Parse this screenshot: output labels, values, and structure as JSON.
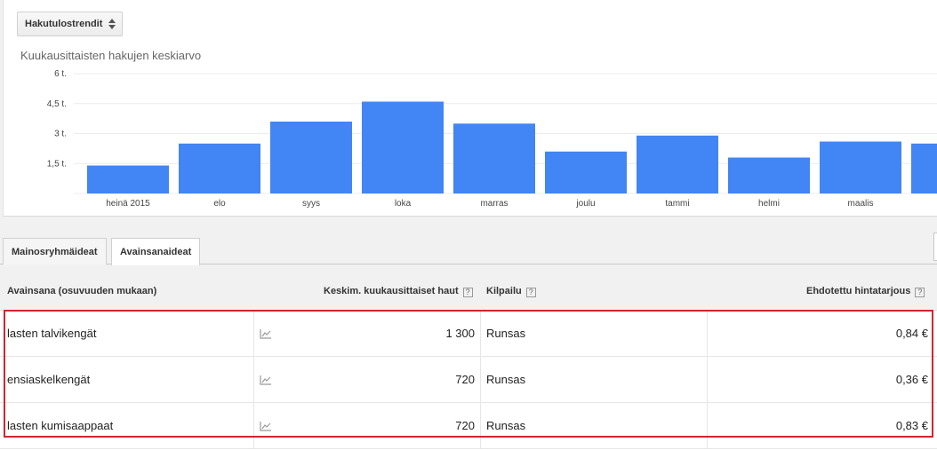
{
  "toolbar": {
    "select_label": "Hakutulostrendit",
    "select_icon": "sort-arrows-icon"
  },
  "chart_title": "Kuukausittaisten hakujen keskiarvo",
  "chart_data": {
    "type": "bar",
    "title": "Kuukausittaisten hakujen keskiarvo",
    "categories": [
      "heinä 2015",
      "elo",
      "syys",
      "loka",
      "marras",
      "joulu",
      "tammi",
      "helmi",
      "maalis",
      ""
    ],
    "values": [
      1.4,
      2.5,
      3.6,
      4.6,
      3.5,
      2.1,
      2.9,
      1.8,
      2.6,
      2.5
    ],
    "y_ticks": [
      1.5,
      3,
      4.5,
      6
    ],
    "y_tick_labels": [
      "1,5 t.",
      "3 t.",
      "4,5 t.",
      "6 t."
    ],
    "ylim": [
      0,
      6
    ],
    "bar_color": "#4285f4",
    "grid": true
  },
  "tabs": [
    {
      "label": "Mainosryhmäideat",
      "active": false
    },
    {
      "label": "Avainsanaideat",
      "active": true
    }
  ],
  "table": {
    "headers": {
      "keyword": "Avainsana (osuvuuden mukaan)",
      "avg": "Keskim. kuukausittaiset haut",
      "competition": "Kilpailu",
      "bid": "Ehdotettu hintatarjous"
    },
    "help_glyph": "?",
    "rows": [
      {
        "keyword": "lasten talvikengät",
        "avg": "1 300",
        "competition": "Runsas",
        "bid": "0,84 €"
      },
      {
        "keyword": "ensiaskelkengät",
        "avg": "720",
        "competition": "Runsas",
        "bid": "0,36 €"
      },
      {
        "keyword": "lasten kumisaappaat",
        "avg": "720",
        "competition": "Runsas",
        "bid": "0,83 €"
      }
    ]
  },
  "colors": {
    "accent": "#4285f4",
    "highlight": "#d0262d"
  }
}
